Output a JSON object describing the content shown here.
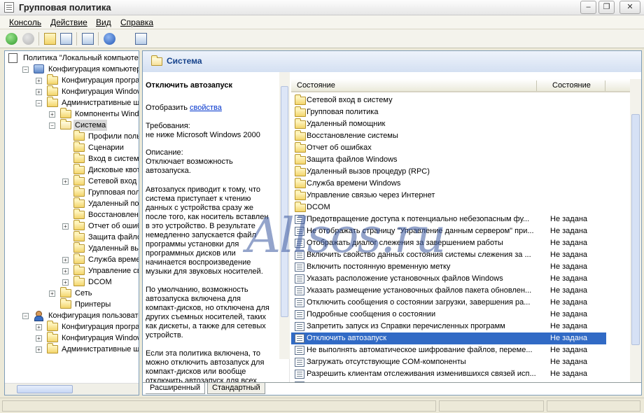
{
  "window": {
    "title": "Групповая политика",
    "minimize": "–",
    "restore": "❐",
    "close": "✕"
  },
  "menu": [
    "Консоль",
    "Действие",
    "Вид",
    "Справка"
  ],
  "toolbar": {
    "icons": [
      "back-icon",
      "forward-icon",
      "up-folder-icon",
      "show-hide-tree-icon",
      "export-list-icon",
      "help-icon",
      "properties-icon"
    ]
  },
  "tree": {
    "items": [
      {
        "label": "Политика \"Локальный компьюте",
        "level": 0,
        "icon": "policy"
      },
      {
        "label": "Конфигурация компьютера",
        "level": 1,
        "icon": "pc",
        "exp": "−"
      },
      {
        "label": "Конфигурация программ",
        "level": 2,
        "icon": "folder",
        "exp": "+"
      },
      {
        "label": "Конфигурация Windows",
        "level": 2,
        "icon": "folder",
        "exp": "+"
      },
      {
        "label": "Административные шабл",
        "level": 2,
        "icon": "folder",
        "exp": "−"
      },
      {
        "label": "Компоненты Windows",
        "level": 3,
        "icon": "folder",
        "exp": "+"
      },
      {
        "label": "Система",
        "level": 3,
        "icon": "folder-open",
        "exp": "−",
        "selected": true
      },
      {
        "label": "Профили пользова",
        "level": 4,
        "icon": "folder"
      },
      {
        "label": "Сценарии",
        "level": 4,
        "icon": "folder"
      },
      {
        "label": "Вход в систему",
        "level": 4,
        "icon": "folder"
      },
      {
        "label": "Дисковые квоты",
        "level": 4,
        "icon": "folder"
      },
      {
        "label": "Сетевой вход в с",
        "level": 4,
        "icon": "folder",
        "exp": "+"
      },
      {
        "label": "Групповая полити",
        "level": 4,
        "icon": "folder"
      },
      {
        "label": "Удаленный помощ",
        "level": 4,
        "icon": "folder"
      },
      {
        "label": "Восстановление с",
        "level": 4,
        "icon": "folder"
      },
      {
        "label": "Отчет об ошибках",
        "level": 4,
        "icon": "folder",
        "exp": "+"
      },
      {
        "label": "Защита файлов W",
        "level": 4,
        "icon": "folder"
      },
      {
        "label": "Удаленный вызов",
        "level": 4,
        "icon": "folder"
      },
      {
        "label": "Служба времени W",
        "level": 4,
        "icon": "folder",
        "exp": "+"
      },
      {
        "label": "Управление связь",
        "level": 4,
        "icon": "folder",
        "exp": "+"
      },
      {
        "label": "DCOM",
        "level": 4,
        "icon": "folder",
        "exp": "+"
      },
      {
        "label": "Сеть",
        "level": 3,
        "icon": "folder",
        "exp": "+"
      },
      {
        "label": "Принтеры",
        "level": 3,
        "icon": "folder"
      },
      {
        "label": "Конфигурация пользователя",
        "level": 1,
        "icon": "user",
        "exp": "−"
      },
      {
        "label": "Конфигурация программ",
        "level": 2,
        "icon": "folder",
        "exp": "+"
      },
      {
        "label": "Конфигурация Windows",
        "level": 2,
        "icon": "folder",
        "exp": "+"
      },
      {
        "label": "Административные шабл",
        "level": 2,
        "icon": "folder",
        "exp": "+"
      }
    ]
  },
  "right_header": "Система",
  "extended": {
    "title": "Отключить автозапуск",
    "show_label": "Отобразить",
    "properties_link": "свойства",
    "requirements": "Требования:\nне ниже Microsoft Windows 2000",
    "description": "Описание:\nОтключает возможность автозапуска.",
    "para1": "Автозапуск приводит к тому, что система приступает к чтению данных с устройства сразу же после того, как носитель вставлен в это устройство. В результате немедленно запускается файл программы установки для программных дисков или начинается воспроизведение музыки для звуковых носителей.",
    "para2": "По умолчанию, возможность автозапуска включена для компакт-дисков, но отключена для других съемных носителей, таких как дискеты, а также для сетевых устройств.",
    "para3": "Если эта политика включена, то можно отключить автозапуск для компакт-дисков или вообще отключить автозапуск для всех"
  },
  "list": {
    "col_name": "Состояние",
    "col_state": "Состояние",
    "rows": [
      {
        "type": "folder",
        "name": "Сетевой вход в систему",
        "state": ""
      },
      {
        "type": "folder",
        "name": "Групповая политика",
        "state": ""
      },
      {
        "type": "folder",
        "name": "Удаленный помощник",
        "state": ""
      },
      {
        "type": "folder",
        "name": "Восстановление системы",
        "state": ""
      },
      {
        "type": "folder",
        "name": "Отчет об ошибках",
        "state": ""
      },
      {
        "type": "folder",
        "name": "Защита файлов Windows",
        "state": ""
      },
      {
        "type": "folder",
        "name": "Удаленный вызов процедур (RPC)",
        "state": ""
      },
      {
        "type": "folder",
        "name": "Служба времени Windows",
        "state": ""
      },
      {
        "type": "folder",
        "name": "Управление связью через Интернет",
        "state": ""
      },
      {
        "type": "folder",
        "name": "DCOM",
        "state": ""
      },
      {
        "type": "setting",
        "name": "Предотвращение доступа к потенциально небезопасным фу...",
        "state": "Не задана"
      },
      {
        "type": "setting",
        "name": "Не отображать страницу \"Управление данным сервером\" при...",
        "state": "Не задана"
      },
      {
        "type": "setting",
        "name": "Отображать диалог слежения за завершением работы",
        "state": "Не задана"
      },
      {
        "type": "setting",
        "name": "Включить свойство данных состояния системы слежения за ...",
        "state": "Не задана"
      },
      {
        "type": "setting",
        "name": "Включить постоянную временную метку",
        "state": "Не задана"
      },
      {
        "type": "setting",
        "name": "Указать расположение установочных файлов Windows",
        "state": "Не задана"
      },
      {
        "type": "setting",
        "name": "Указать размещение установочных файлов пакета обновлен...",
        "state": "Не задана"
      },
      {
        "type": "setting",
        "name": "Отключить сообщения о состоянии загрузки, завершения ра...",
        "state": "Не задана"
      },
      {
        "type": "setting",
        "name": "Подробные сообщения о состоянии",
        "state": "Не задана"
      },
      {
        "type": "setting",
        "name": "Запретить запуск из Справки перечисленных программ",
        "state": "Не задана"
      },
      {
        "type": "setting",
        "name": "Отключить автозапуск",
        "state": "Не задана",
        "selected": true
      },
      {
        "type": "setting",
        "name": "Не выполнять автоматическое шифрование файлов, переме...",
        "state": "Не задана"
      },
      {
        "type": "setting",
        "name": "Загружать отсутствующие COM-компоненты",
        "state": "Не задана"
      },
      {
        "type": "setting",
        "name": "Разрешить клиентам отслеживания изменившихся связей исп...",
        "state": "Не задана"
      },
      {
        "type": "setting",
        "name": "",
        "state": "Не задана"
      }
    ]
  },
  "tabs": [
    "Расширенный",
    "Стандартный"
  ],
  "watermark": "Allsos.ru"
}
